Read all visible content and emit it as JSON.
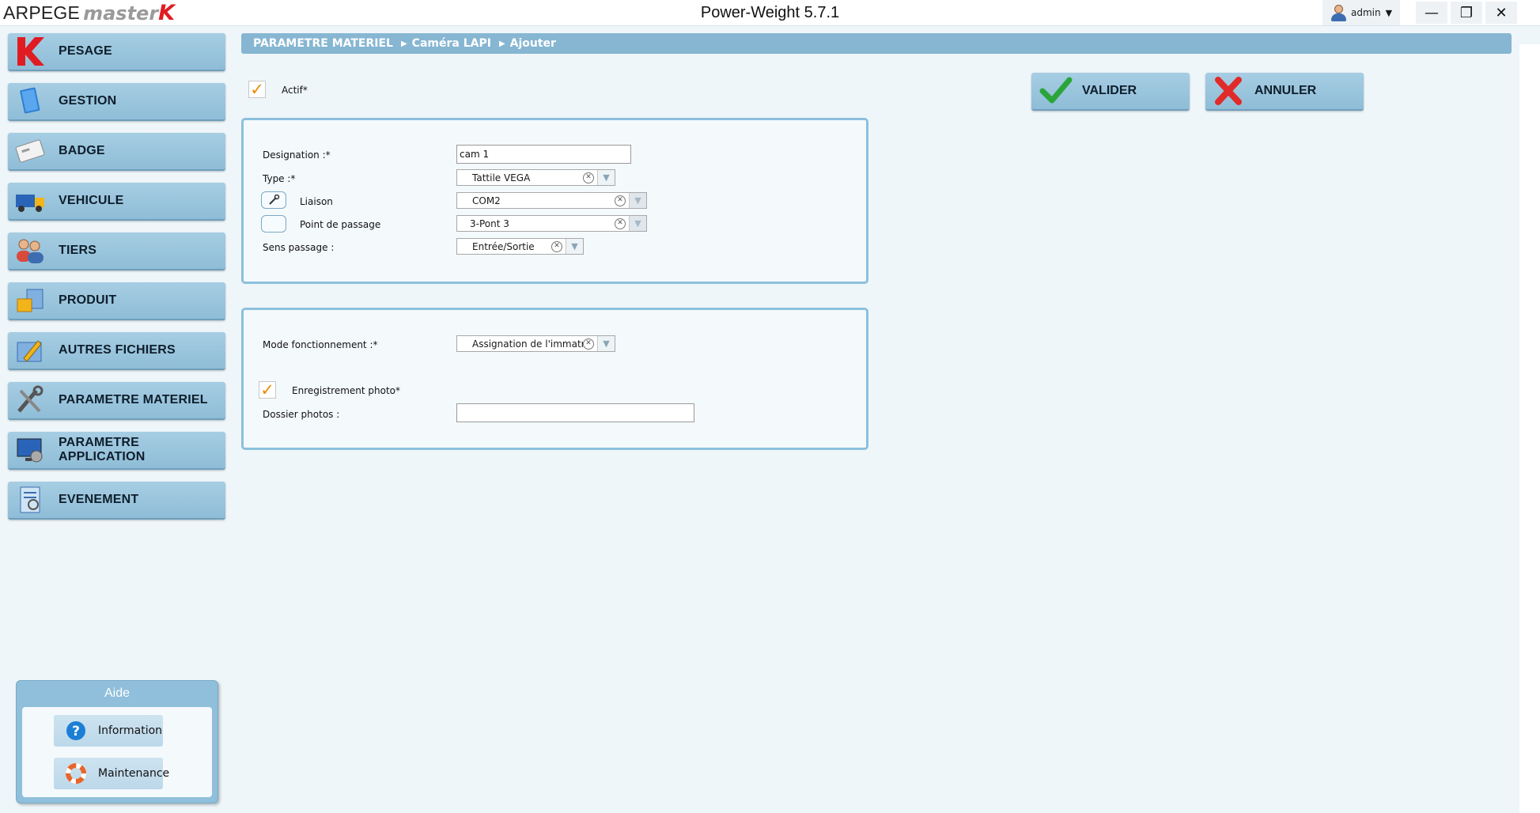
{
  "app": {
    "brand_main": "ARPEGE",
    "brand_styled": "MASTER",
    "brand_k": "K",
    "title": "Power-Weight 5.7.1",
    "user": "admin"
  },
  "window_controls": {
    "minimize": "—",
    "restore": "❐",
    "close": "✕"
  },
  "menu": {
    "items": [
      {
        "label": "PESAGE"
      },
      {
        "label": "GESTION"
      },
      {
        "label": "BADGE"
      },
      {
        "label": "VEHICULE"
      },
      {
        "label": "TIERS"
      },
      {
        "label": "PRODUIT"
      },
      {
        "label": "AUTRES FICHIERS"
      },
      {
        "label": "PARAMETRE MATERIEL"
      },
      {
        "label": "PARAMETRE APPLICATION"
      },
      {
        "label": "EVENEMENT"
      }
    ]
  },
  "breadcrumb": [
    "PARAMETRE MATERIEL",
    "Caméra LAPI",
    "Ajouter"
  ],
  "form": {
    "actif_label": "Actif*",
    "actif_checked": "✓",
    "designation_label": "Designation :*",
    "designation_value": "cam 1",
    "type_label": "Type :*",
    "type_value": "Tattile VEGA",
    "liaison_label": "Liaison",
    "liaison_value": "COM2",
    "point_label": "Point de passage",
    "point_value": "3-Pont 3",
    "sens_label": "Sens passage :",
    "sens_value": "Entrée/Sortie",
    "mode_label": "Mode fonctionnement :*",
    "mode_value": "Assignation de l'immatri",
    "photo_label": "Enregistrement photo*",
    "photo_checked": "✓",
    "dossier_label": "Dossier photos :",
    "dossier_value": ""
  },
  "actions": {
    "validate": "VALIDER",
    "cancel": "ANNULER"
  },
  "aide": {
    "title": "Aide",
    "information": "Information",
    "maintenance": "Maintenance"
  },
  "colors": {
    "menu_button": "#9bc6df",
    "breadcrumb": "#86b6d2",
    "panel_border": "#8cc0dc",
    "check_orange": "#f08a00",
    "brand_red": "#e11b22"
  }
}
